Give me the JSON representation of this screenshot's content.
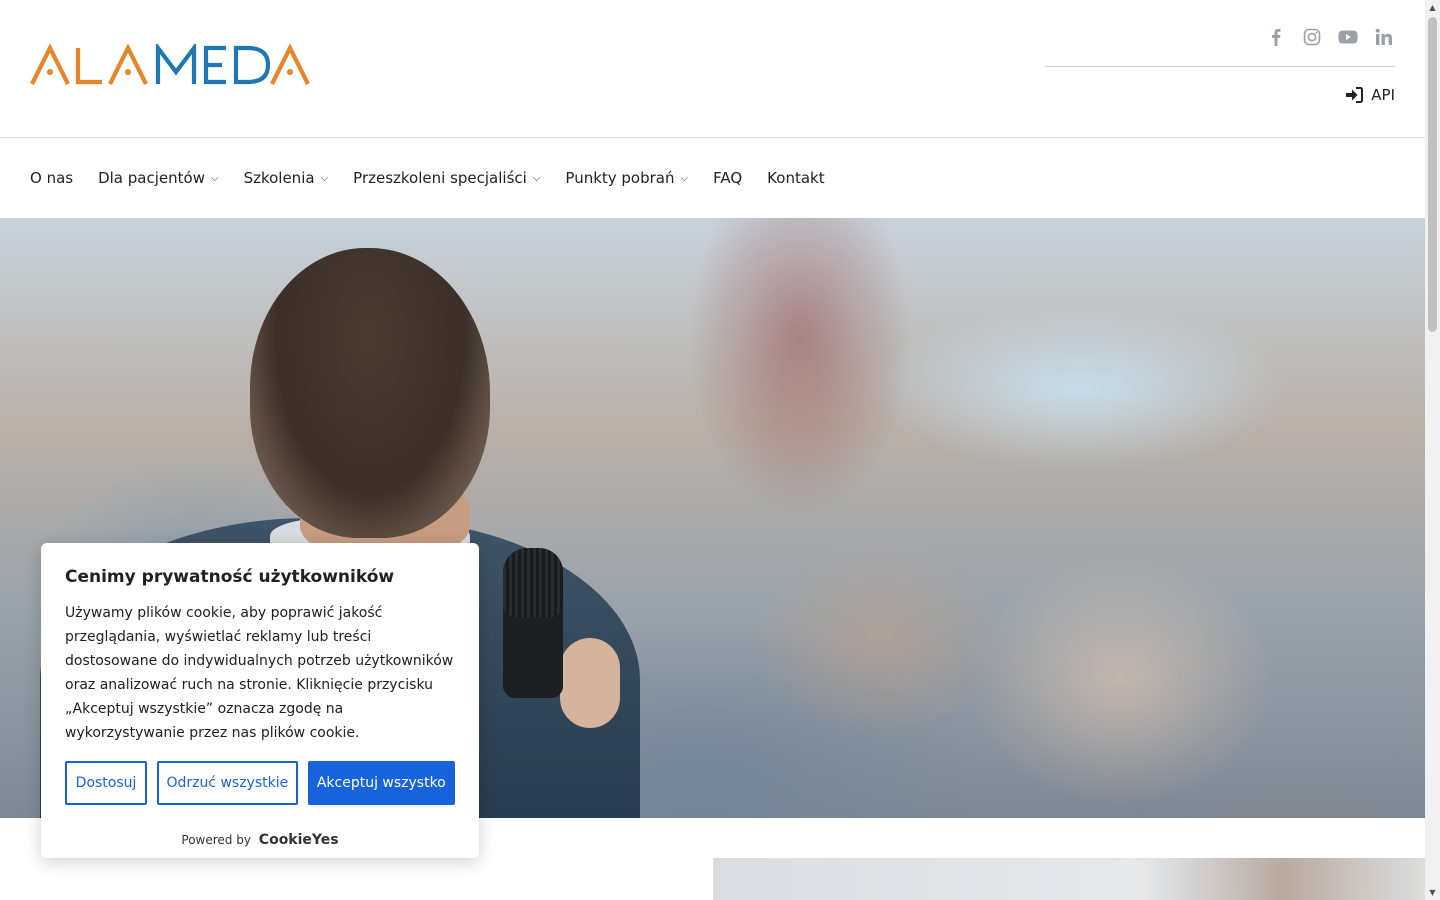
{
  "header": {
    "logo_text": "ALAMEDA",
    "social_icons": [
      "facebook-icon",
      "instagram-icon",
      "youtube-icon",
      "linkedin-icon"
    ],
    "api_label": "API"
  },
  "nav": {
    "items": [
      {
        "label": "O nas",
        "has_dropdown": false
      },
      {
        "label": "Dla pacjentów",
        "has_dropdown": true
      },
      {
        "label": "Szkolenia",
        "has_dropdown": true
      },
      {
        "label": "Przeszkoleni specjaliści",
        "has_dropdown": true
      },
      {
        "label": "Punkty pobrań",
        "has_dropdown": true
      },
      {
        "label": "FAQ",
        "has_dropdown": false
      },
      {
        "label": "Kontakt",
        "has_dropdown": false
      }
    ]
  },
  "cookie": {
    "title": "Cenimy prywatność użytkowników",
    "text": "Używamy plików cookie, aby poprawić jakość przeglądania, wyświetlać reklamy lub treści dostosowane do indywidualnych potrzeb użytkowników oraz analizować ruch na stronie. Kliknięcie przycisku „Akceptuj wszystkie” oznacza zgodę na wykorzystywanie przez nas plików cookie.",
    "btn_customize": "Dostosuj",
    "btn_reject": "Odrzuć wszystkie",
    "btn_accept": "Akceptuj wszystko",
    "powered_by": "Powered by",
    "brand": "CookieYes"
  },
  "colors": {
    "logo_orange": "#e8852a",
    "logo_blue": "#1f78b4",
    "cookie_accent": "#1863dc"
  }
}
